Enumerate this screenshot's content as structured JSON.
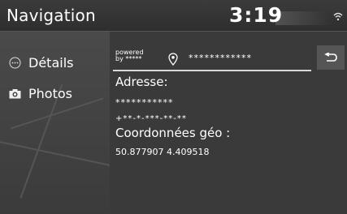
{
  "header": {
    "title": "Navigation",
    "time": "3:19"
  },
  "sidebar": {
    "items": [
      {
        "label": "Détails",
        "icon": "ellipsis-icon"
      },
      {
        "label": "Photos",
        "icon": "camera-icon"
      }
    ]
  },
  "details": {
    "powered_line1": "powered",
    "powered_line2": "by *****",
    "place_name": "************",
    "address_label": "Adresse:",
    "address_value": "***********",
    "phone_value": "+**-*-***-**-**",
    "coords_label": "Coordonnées géo :",
    "coords_value": "50.877907 4.409518"
  },
  "colors": {
    "background": "#3a3a3a",
    "topbar": "#2e2e2e",
    "text": "#ffffff"
  }
}
